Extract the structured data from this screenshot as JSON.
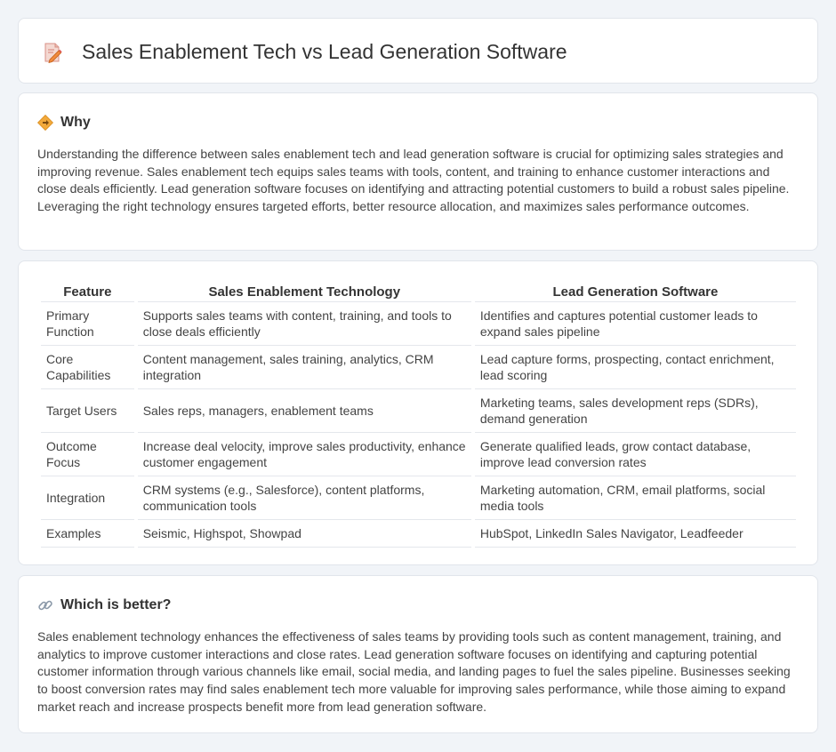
{
  "page": {
    "title": "Sales Enablement Tech vs Lead Generation Software",
    "title_icon": "document-pencil-icon"
  },
  "why": {
    "heading": "Why",
    "icon": "diamond-signpost-icon",
    "text": "Understanding the difference between sales enablement tech and lead generation software is crucial for optimizing sales strategies and improving revenue. Sales enablement tech equips sales teams with tools, content, and training to enhance customer interactions and close deals efficiently. Lead generation software focuses on identifying and attracting potential customers to build a robust sales pipeline. Leveraging the right technology ensures targeted efforts, better resource allocation, and maximizes sales performance outcomes."
  },
  "table": {
    "headers": [
      "Feature",
      "Sales Enablement Technology",
      "Lead Generation Software"
    ],
    "rows": [
      [
        "Primary Function",
        "Supports sales teams with content, training, and tools to close deals efficiently",
        "Identifies and captures potential customer leads to expand sales pipeline"
      ],
      [
        "Core Capabilities",
        "Content management, sales training, analytics, CRM integration",
        "Lead capture forms, prospecting, contact enrichment, lead scoring"
      ],
      [
        "Target Users",
        "Sales reps, managers, enablement teams",
        "Marketing teams, sales development reps (SDRs), demand generation"
      ],
      [
        "Outcome Focus",
        "Increase deal velocity, improve sales productivity, enhance customer engagement",
        "Generate qualified leads, grow contact database, improve lead conversion rates"
      ],
      [
        "Integration",
        "CRM systems (e.g., Salesforce), content platforms, communication tools",
        "Marketing automation, CRM, email platforms, social media tools"
      ],
      [
        "Examples",
        "Seismic, Highspot, Showpad",
        "HubSpot, LinkedIn Sales Navigator, Leadfeeder"
      ]
    ]
  },
  "better": {
    "heading": "Which is better?",
    "icon": "link-icon",
    "text": "Sales enablement technology enhances the effectiveness of sales teams by providing tools such as content management, training, and analytics to improve customer interactions and close rates. Lead generation software focuses on identifying and capturing potential customer information through various channels like email, social media, and landing pages to fuel the sales pipeline. Businesses seeking to boost conversion rates may find sales enablement tech more valuable for improving sales performance, while those aiming to expand market reach and increase prospects benefit more from lead generation software."
  }
}
